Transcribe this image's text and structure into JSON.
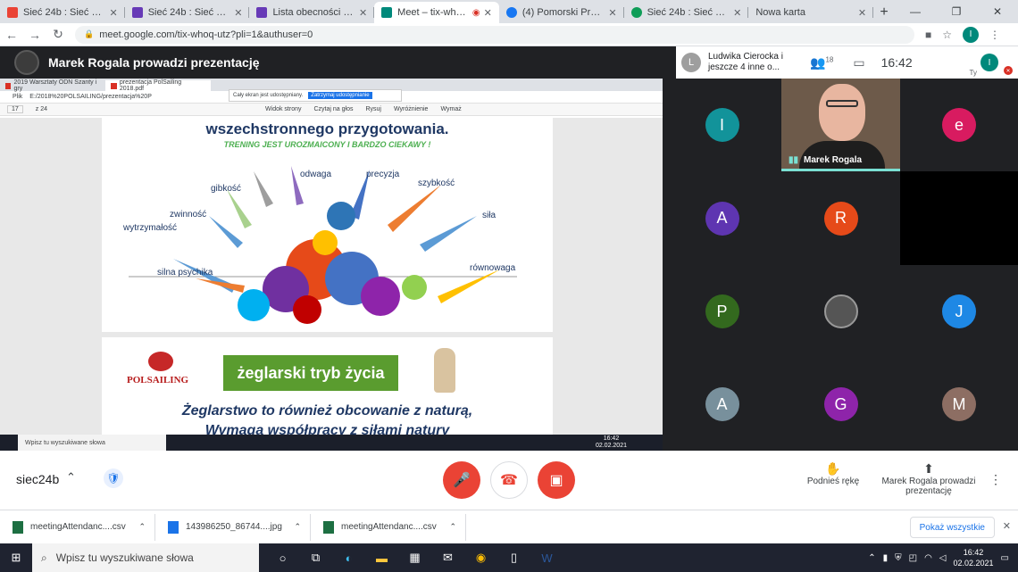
{
  "tabs": [
    {
      "label": "Sieć 24b : Sieć szkolnych",
      "icon": "gmail-icon",
      "color": "#ea4335",
      "active": false
    },
    {
      "label": "Sieć 24b : Sieć szkolnych",
      "icon": "forms-icon",
      "color": "#673ab7",
      "active": false
    },
    {
      "label": "Lista obecności Sieć 24",
      "icon": "forms-icon",
      "color": "#673ab7",
      "active": false
    },
    {
      "label": "Meet – tix-whoq-u",
      "icon": "meet-icon",
      "color": "#00897b",
      "active": true
    },
    {
      "label": "(4) Pomorski Program",
      "icon": "facebook-icon",
      "color": "#1877f2",
      "active": false
    },
    {
      "label": "Sieć 24b : Sieć Szkolnych",
      "icon": "classroom-icon",
      "color": "#0f9d58",
      "active": false
    },
    {
      "label": "Nowa karta",
      "icon": "",
      "color": "",
      "active": false
    }
  ],
  "address": {
    "url": "meet.google.com/tix-whoq-utz?pli=1&authuser=0",
    "profile_initial": "I"
  },
  "meet": {
    "title": "Marek Rogala prowadzi prezentację",
    "top_participant_initial": "L",
    "top_participant_text": "Ludwika Cierocka i jeszcze 4 inne o...",
    "people_count": "18",
    "clock": "16:42",
    "me_label": "Ty",
    "me_initial": "I"
  },
  "shared": {
    "inner_tab1": "2019 Warsztaty ODN Szanty i gry",
    "inner_tab2": "prezentacja PolSailing 2018.pdf",
    "inner_url": "E:/2018%20POLSAILING/prezentacja%20P",
    "inner_url_prefix": "Plik",
    "sharebar_text": "Cały ekran jest udostępniany.",
    "sharebar_stop": "Zatrzymaj udostępnianie",
    "pdf_page": "17",
    "pdf_total": "z 24",
    "tool_view": "Widok strony",
    "tool_read": "Czytaj na głos",
    "tool_draw": "Rysuj",
    "tool_highlight": "Wyróżnienie",
    "tool_erase": "Wymaż",
    "slide_title": "wszechstronnego przygotowania.",
    "slide_subtitle": "TRENING JEST UROZMAICONY I BARDZO CIEKAWY !",
    "words": {
      "odwaga": "odwaga",
      "precyzja": "precyzja",
      "gibkosc": "gibkość",
      "szybkosc": "szybkość",
      "zwinnosc": "zwinność",
      "sila": "siła",
      "wytrzymalosc": "wytrzymałość",
      "rownowaga": "równowaga",
      "silna_psychika": "silna psychika"
    },
    "logo_text": "POLSAILING",
    "green_box": "żeglarski tryb życia",
    "quote1": "Żeglarstwo to również obcowanie z naturą,",
    "quote2": "Wymaga współpracy z siłami natury",
    "inner_search": "Wpisz tu wyszukiwane słowa",
    "inner_time": "16:42",
    "inner_date": "02.02.2021"
  },
  "participants": [
    {
      "initial": "I",
      "color": "#12939a"
    },
    {
      "initial": "e",
      "color": "#d81b60"
    },
    {
      "initial": "A",
      "color": "#5e35b1"
    },
    {
      "initial": "R",
      "color": "#e64a19"
    },
    {
      "initial": "P",
      "color": "#33691e"
    },
    {
      "initial": "J",
      "color": "#1e88e5"
    },
    {
      "initial": "A",
      "color": "#78909c"
    },
    {
      "initial": "G",
      "color": "#8e24aa"
    },
    {
      "initial": "M",
      "color": "#8d6e63"
    }
  ],
  "video": {
    "name": "Marek Rogala"
  },
  "controls": {
    "meeting_code": "siec24b",
    "raise_hand": "Podnieś rękę",
    "presenting": "Marek Rogala prowadzi prezentację"
  },
  "downloads": [
    {
      "name": "meetingAttendanc....csv",
      "icon": "excel-icon",
      "color": "#1d6f42"
    },
    {
      "name": "143986250_86744....jpg",
      "icon": "image-icon",
      "color": "#1a73e8"
    },
    {
      "name": "meetingAttendanc....csv",
      "icon": "excel-icon",
      "color": "#1d6f42"
    }
  ],
  "show_all": "Pokaż wszystkie",
  "taskbar": {
    "search": "Wpisz tu wyszukiwane słowa",
    "time": "16:42",
    "date": "02.02.2021"
  }
}
